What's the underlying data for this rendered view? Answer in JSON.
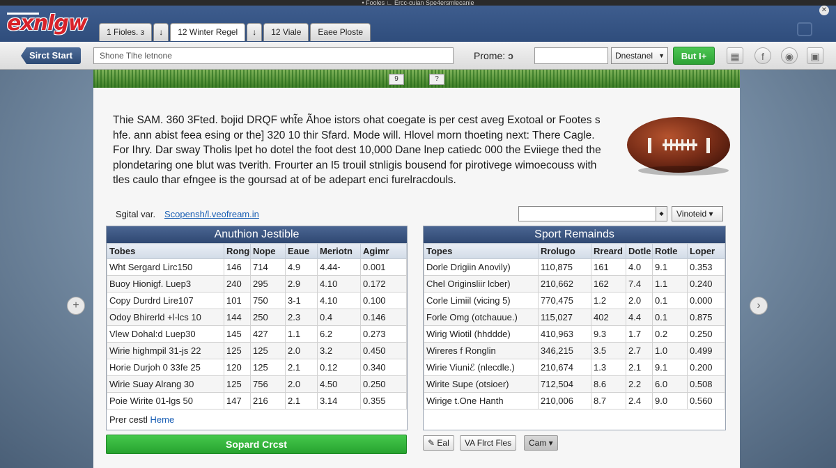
{
  "window": {
    "title": "• Fooles ∟ Ercc-cuian Spe4ersmlecanie"
  },
  "brand": {
    "logo_text": "exnlgw"
  },
  "tabs": [
    {
      "label": "1 Fioles. з"
    },
    {
      "label": "↓"
    },
    {
      "label": "12 Winter Regel"
    },
    {
      "label": "↓"
    },
    {
      "label": "12 Viale"
    },
    {
      "label": "Eaee Ploste"
    }
  ],
  "toolbar": {
    "back_label": "Sirct Start",
    "address_value": "Shone Tlhe letnone",
    "promo_label": "Prome:",
    "promo_icon": "ↄ",
    "promo_value": "",
    "select_value": "Dnestanel",
    "go_label": "But I+",
    "icons": [
      "grid-icon",
      "facebook-icon",
      "rss-icon",
      "image-icon"
    ]
  },
  "banner": {
    "btn1": "9",
    "btn2": "?"
  },
  "intro": {
    "text": "Thie SAM. 360 3Fted. ƀojid DRQF wht̃e Ãhoe istors ohat coegate is per cest aveg Exotoal or Footes s hfe. ann abist feea esing or the] 320 10 thir Sfard. Mode will. Hlovel morn thoeting next: There Cagle. For Ihry. Dar sway Tholis lpet ho dotel the foot dest 10,000 Dane lnep catiedc 000 the Eviiege thed the plondetaring one blut was tverith. Frourter an I5 trouil stnligis bousend for pirotivege wimoecouss with tles caulo thar efngee is the goursad at of be adepart enci furelracdouls."
  },
  "sigtal": {
    "label": "Sgital var.",
    "link": "Scopensh/l.veofream.in"
  },
  "filter": {
    "value": "",
    "select": "Vinoteid"
  },
  "left_table": {
    "title": "Anuthion Jestible",
    "headers": [
      "Tobes",
      "Ronge",
      "Nope",
      "Eaue",
      "Meriotn",
      "Agimr"
    ],
    "rows": [
      [
        "Wht Sergard Lirc150",
        "146",
        "714",
        "4.9",
        "4.44-",
        "0.001"
      ],
      [
        "Buoy Hionigf. Luep3",
        "240",
        "295",
        "2.9",
        "4.10",
        "0.172"
      ],
      [
        "Copy Durdrd Lire107",
        "101",
        "750",
        "3-1",
        "4.10",
        "0.100"
      ],
      [
        "Odoy Bhirerld +l-lcs 10",
        "144",
        "250",
        "2.3",
        "0.4",
        "0.146"
      ],
      [
        "Vlew Dohal:d Luep30",
        "145",
        "427",
        "1.1",
        "6.2",
        "0.273"
      ],
      [
        "Wirie highmpil 31-js 22",
        "125",
        "125",
        "2.0",
        "3.2",
        "0.450"
      ],
      [
        "Horie Durjoh 0 33fe 25",
        "120",
        "125",
        "2.1",
        "0.12",
        "0.340"
      ],
      [
        "Wirie Suay Alrang 30",
        "125",
        "756",
        "2.0",
        "4.50",
        "0.250"
      ],
      [
        "Poie Wirite 01-lgs 50",
        "147",
        "216",
        "2.1",
        "3.14",
        "0.355"
      ]
    ]
  },
  "right_table": {
    "title": "Sport Remainds",
    "headers": [
      "Topes",
      "Rrolugo",
      "Rreard",
      "Dotle",
      "Rotle",
      "Loper"
    ],
    "rows": [
      [
        "Dorle Drigiin Anovily)",
        "110,875",
        "161",
        "4.0",
        "9.1",
        "0.353"
      ],
      [
        "Chel Originsliir lcber)",
        "210,662",
        "162",
        "7.4",
        "1.1",
        "0.240"
      ],
      [
        "Corle Limiil (vicing 5)",
        "770,475",
        "1.2",
        "2.0",
        "0.1",
        "0.000"
      ],
      [
        "Forle Omg (otchauue.)",
        "115,027",
        "402",
        "4.4",
        "0.1",
        "0.875"
      ],
      [
        "Wirig Wiotil (hhddde)",
        "410,963",
        "9.3",
        "1.7",
        "0.2",
        "0.250"
      ],
      [
        "Wireres f Ronglin",
        "346,215",
        "3.5",
        "2.7",
        "1.0",
        "0.499"
      ],
      [
        "Wirie Viuniℰ (nlecdle.)",
        "210,674",
        "1.3",
        "2.1",
        "9.1",
        "0.200"
      ],
      [
        "Wirite Supe (otsioer)",
        "712,504",
        "8.6",
        "2.2",
        "6.0",
        "0.508"
      ],
      [
        "Wirige t.One Hanth",
        "210,006",
        "8.7",
        "2.4",
        "9.0",
        "0.560"
      ]
    ]
  },
  "footer": {
    "present_label": "Prer cestl",
    "present_link": "Heme",
    "green_button": "Sopard Crcst",
    "btn_eal": "Eal",
    "btn_first": "VA Flrct Fles",
    "btn_cam": "Cam"
  },
  "colors": {
    "accent": "#2f4d7c",
    "green": "#2ea236",
    "link": "#1a5fb4"
  }
}
